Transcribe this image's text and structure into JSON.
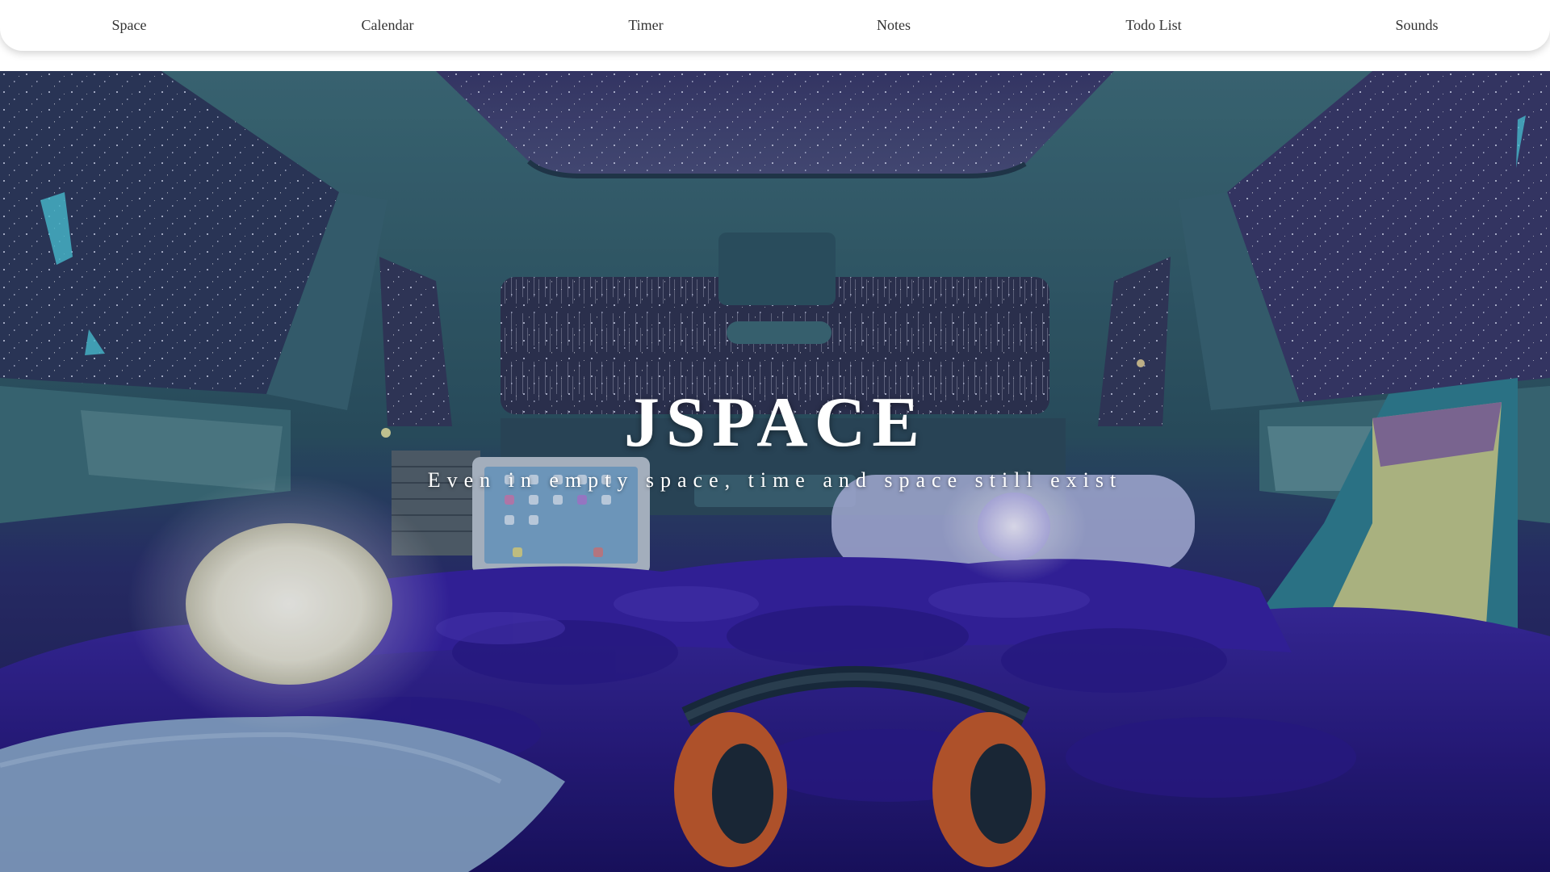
{
  "nav": {
    "items": [
      {
        "label": "Space"
      },
      {
        "label": "Calendar"
      },
      {
        "label": "Timer"
      },
      {
        "label": "Notes"
      },
      {
        "label": "Todo List"
      },
      {
        "label": "Sounds"
      }
    ]
  },
  "hero": {
    "title": "JSPACE",
    "subtitle": "Even in empty space, time and space still exist"
  },
  "colors": {
    "nav_bg": "#ffffff",
    "nav_text": "#333333",
    "hero_text": "#ffffff",
    "scene_teal": "#2f6470",
    "scene_purple": "#2a1f7a",
    "lamp_glow": "#f1efe2"
  }
}
